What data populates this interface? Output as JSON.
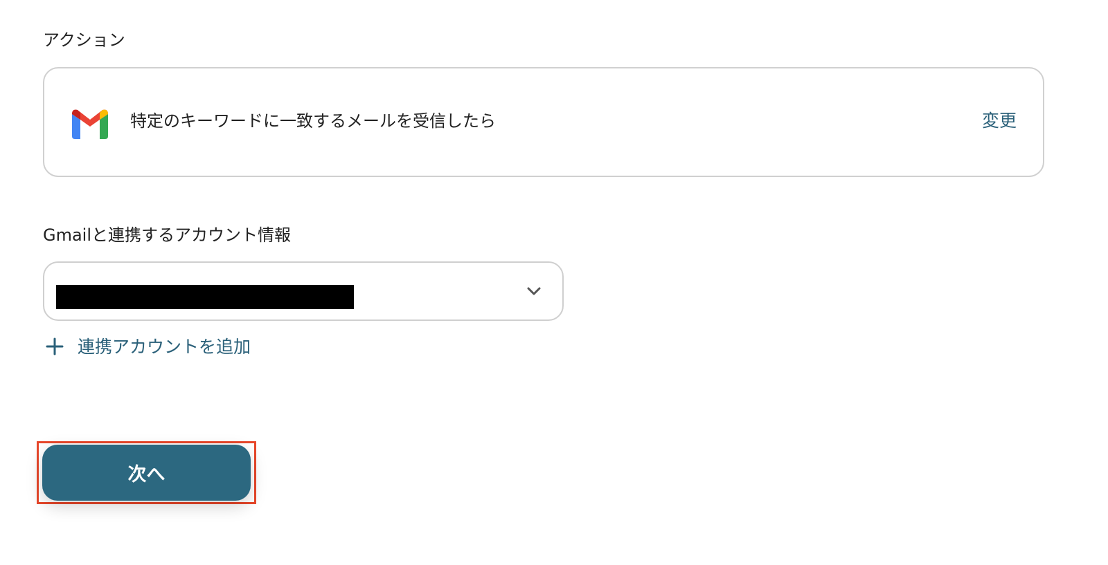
{
  "action_section": {
    "label": "アクション",
    "card": {
      "icon": "gmail-icon",
      "title": "特定のキーワードに一致するメールを受信したら",
      "change_label": "変更"
    }
  },
  "account_section": {
    "label": "Gmailと連携するアカウント情報",
    "select": {
      "selected_value_redacted": true,
      "icon": "chevron-down-icon"
    },
    "add_account": {
      "icon": "plus-icon",
      "label": "連携アカウントを追加"
    }
  },
  "footer": {
    "next_label": "次へ",
    "highlight_color": "#e8472a"
  },
  "colors": {
    "accent": "#2a6079",
    "button": "#2c6880",
    "border": "#d0d0d0"
  }
}
